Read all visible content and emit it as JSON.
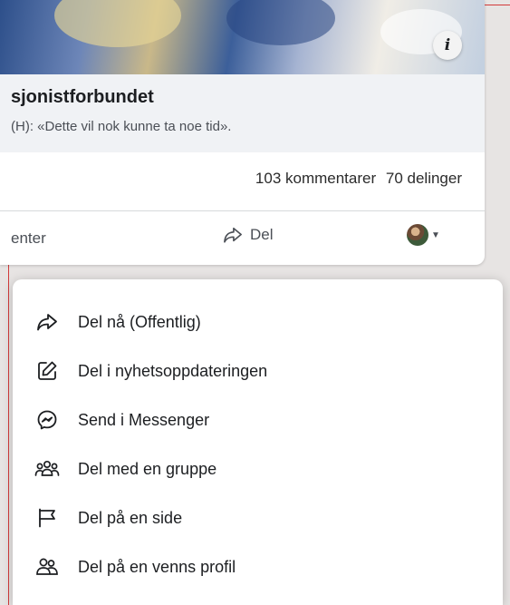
{
  "post": {
    "link_title": "sjonistforbundet",
    "link_subtitle": "(H): «Dette vil nok kunne ta noe tid».",
    "comments": "103 kommentarer",
    "shares": "70 delinger",
    "actions": {
      "comment_label": "enter",
      "share_label": "Del"
    }
  },
  "share_menu": {
    "items": [
      {
        "label": "Del nå (Offentlig)",
        "icon": "share-arrow-icon"
      },
      {
        "label": "Del i nyhetsoppdateringen",
        "icon": "edit-icon"
      },
      {
        "label": "Send i Messenger",
        "icon": "messenger-icon"
      },
      {
        "label": "Del med en gruppe",
        "icon": "group-icon"
      },
      {
        "label": "Del på en side",
        "icon": "flag-icon"
      },
      {
        "label": "Del på en venns profil",
        "icon": "friends-icon"
      }
    ]
  }
}
